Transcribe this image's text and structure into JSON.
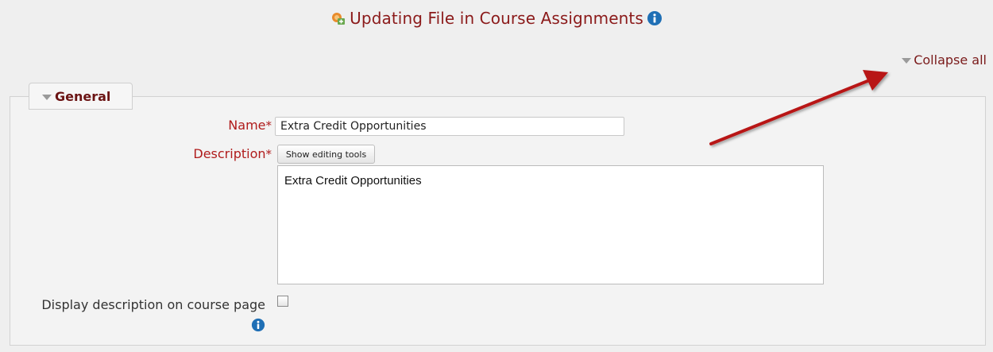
{
  "header": {
    "title": "Updating File in Course Assignments"
  },
  "actions": {
    "collapse_all_label": "Collapse all"
  },
  "general_section": {
    "legend_label": "General"
  },
  "form": {
    "name_label": "Name",
    "required_mark": "*",
    "name_value": "Extra Credit Opportunities",
    "description_label": "Description",
    "show_editing_tools_label": "Show editing tools",
    "description_value": "Extra Credit Opportunities",
    "display_description_label": "Display description on course page",
    "display_description_checked": false
  },
  "colors": {
    "accent": "#8b1a1a",
    "required_label": "#b01c1c",
    "annotation_arrow": "#b81818"
  }
}
